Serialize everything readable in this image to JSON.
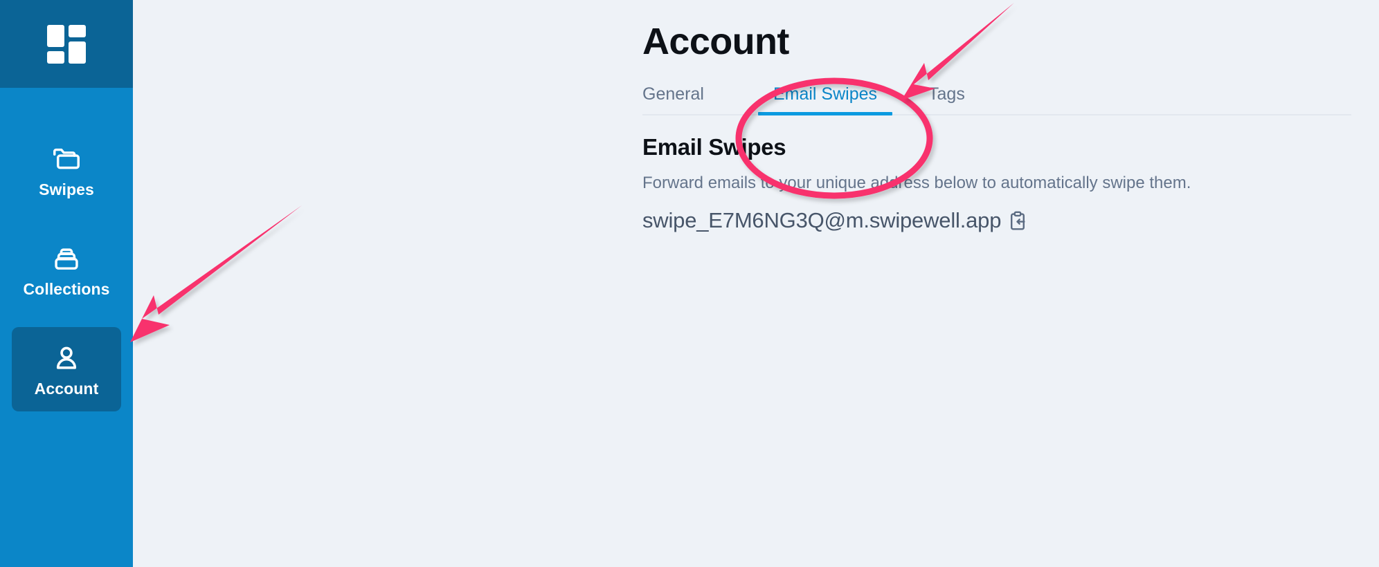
{
  "app": {
    "logo_name": "swipewell-logo",
    "accent_blue": "#0b86c8",
    "sidebar_dark": "#0b6496",
    "page_background": "#eef2f7",
    "annotation_pink": "#f8306d"
  },
  "sidebar": {
    "items": [
      {
        "label": "Swipes",
        "icon": "folder-icon",
        "active": false
      },
      {
        "label": "Collections",
        "icon": "collections-stack-icon",
        "active": false
      },
      {
        "label": "Account",
        "icon": "user-icon",
        "active": true
      }
    ]
  },
  "main": {
    "page_title": "Account",
    "tabs": [
      {
        "label": "General",
        "active": false
      },
      {
        "label": "Email Swipes",
        "active": true
      },
      {
        "label": "Tags",
        "active": false
      }
    ],
    "section": {
      "title": "Email Swipes",
      "description": "Forward emails to your unique address below to automatically swipe them.",
      "email_address": "swipe_E7M6NG3Q@m.swipewell.app",
      "copy_icon": "clipboard-paste-icon"
    }
  },
  "annotations": {
    "highlight_color": "#f8306d",
    "ellipse_target": "Email Swipes tab",
    "arrow_top_target": "Email Swipes tab",
    "arrow_left_target": "Account sidebar item"
  }
}
